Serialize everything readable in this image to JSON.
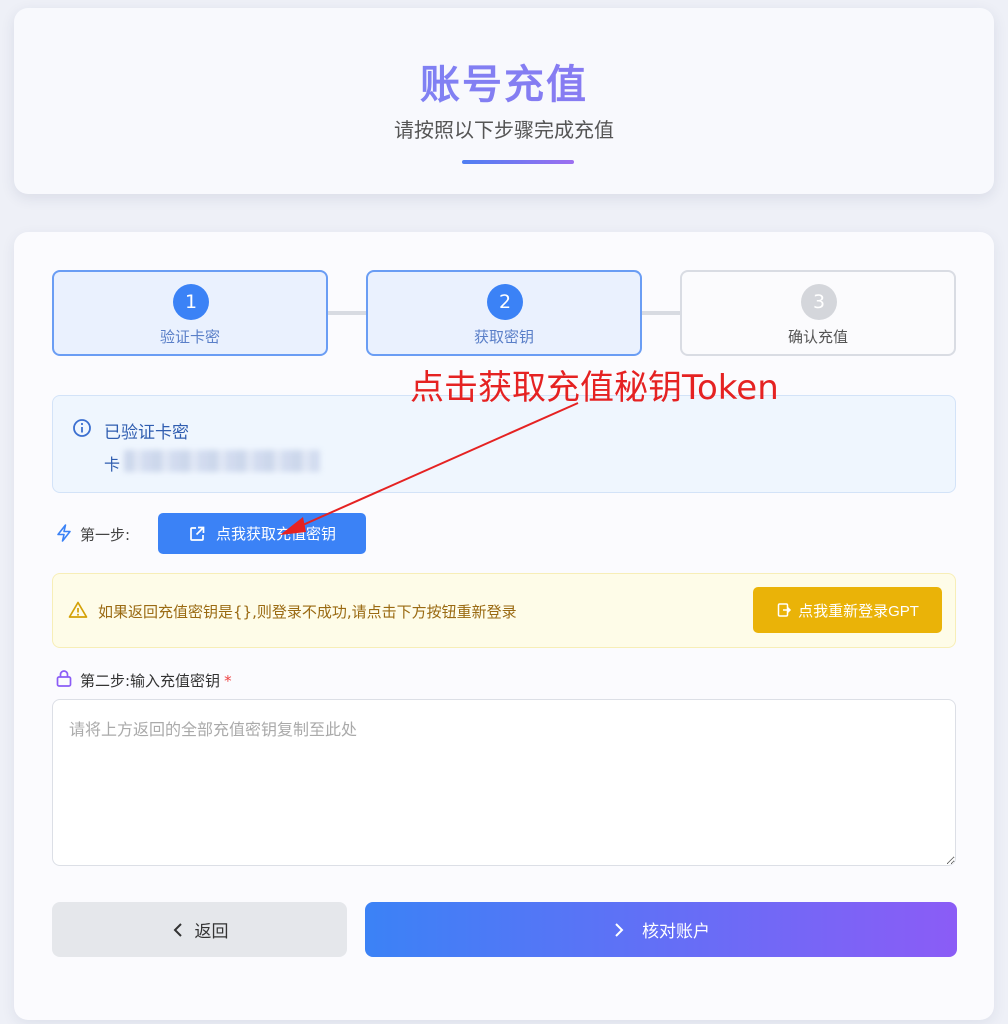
{
  "header": {
    "title": "账号充值",
    "subtitle": "请按照以下步骤完成充值"
  },
  "steps": [
    {
      "number": "1",
      "label": "验证卡密",
      "state": "active"
    },
    {
      "number": "2",
      "label": "获取密钥",
      "state": "active"
    },
    {
      "number": "3",
      "label": "确认充值",
      "state": "inactive"
    }
  ],
  "annotation": {
    "text": "点击获取充值秘钥Token",
    "color": "#e52222"
  },
  "verified": {
    "icon": "info-circle-icon",
    "title": "已验证卡密",
    "card_prefix": "卡"
  },
  "step_one": {
    "icon": "lightning-icon",
    "label": "第一步:",
    "button_icon": "external-link-icon",
    "button_label": "点我获取充值密钥"
  },
  "warning": {
    "icon": "warning-triangle-icon",
    "text": "如果返回充值密钥是{},则登录不成功,请点击下方按钮重新登录",
    "button_icon": "login-icon",
    "button_label": "点我重新登录GPT"
  },
  "step_two": {
    "icon": "lock-icon",
    "label": "第二步:输入充值密钥",
    "required_mark": "*",
    "textarea_placeholder": "请将上方返回的全部充值密钥复制至此处",
    "textarea_value": ""
  },
  "actions": {
    "back_label": "返回",
    "confirm_label": "核对账户"
  },
  "colors": {
    "primary": "#3b82f6",
    "accent_purple": "#8b5cf6",
    "warning": "#eab308",
    "annotation_red": "#e52222"
  }
}
